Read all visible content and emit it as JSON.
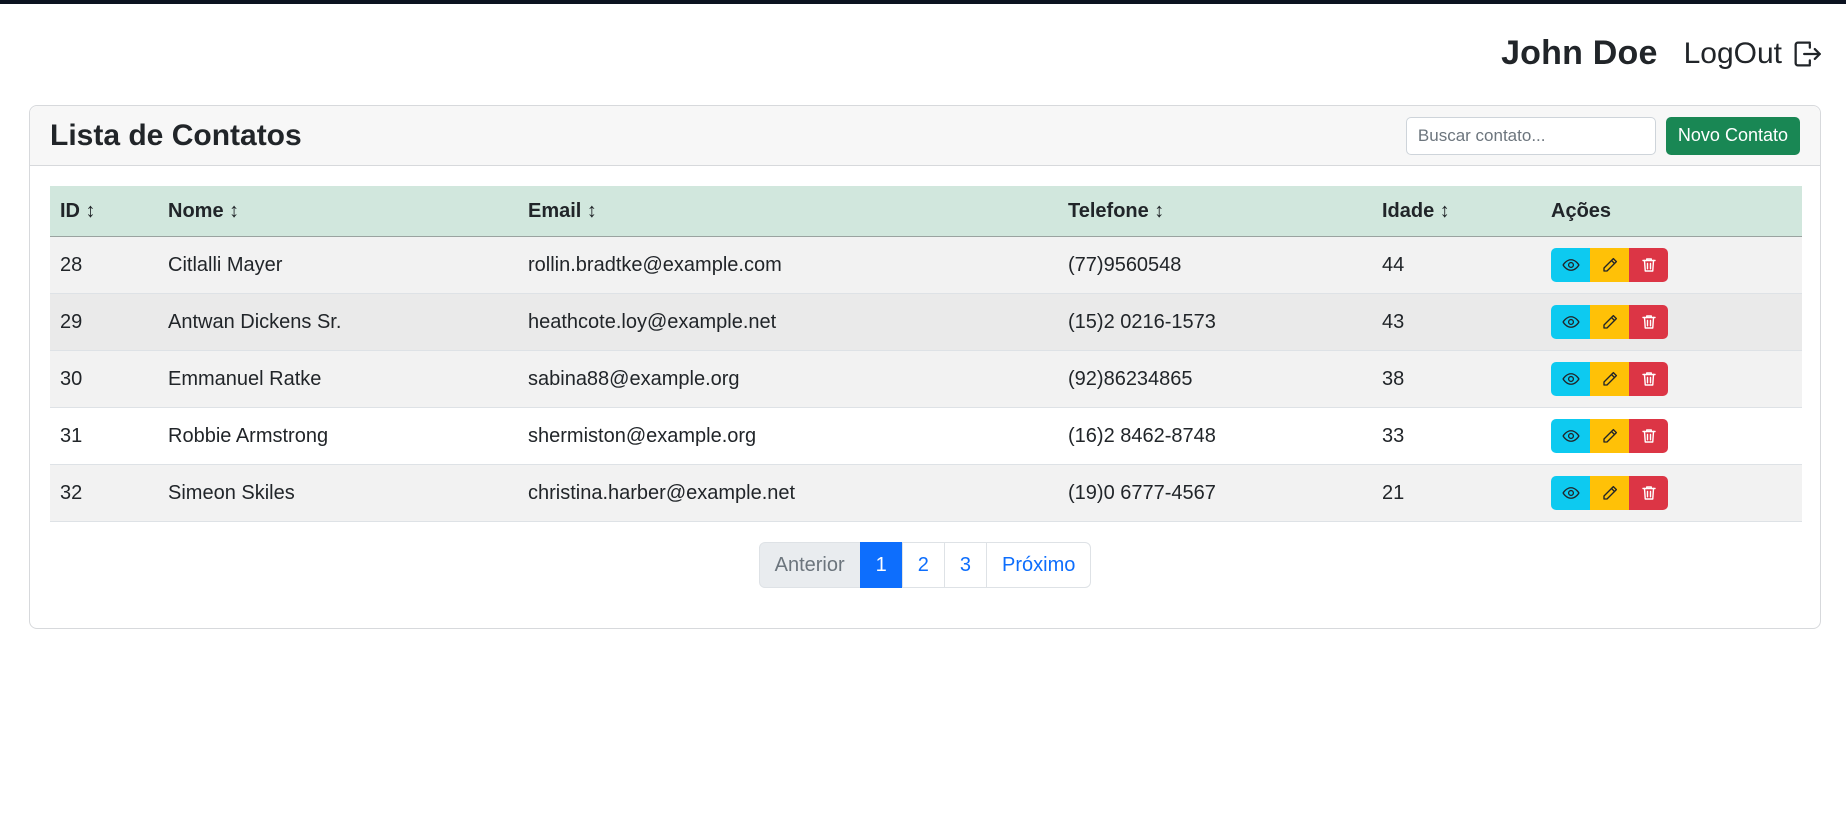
{
  "header": {
    "user_name": "John Doe",
    "logout_label": "LogOut",
    "logout_icon": "logout-icon"
  },
  "card": {
    "title": "Lista de Contatos",
    "search_placeholder": "Buscar contato...",
    "new_button_label": "Novo Contato"
  },
  "table": {
    "columns": [
      "ID ↕",
      "Nome ↕",
      "Email ↕",
      "Telefone ↕",
      "Idade ↕",
      "Ações"
    ],
    "rows": [
      {
        "id": "28",
        "nome": "Citlalli Mayer",
        "email": "rollin.bradtke@example.com",
        "telefone": "(77)9560548",
        "idade": "44"
      },
      {
        "id": "29",
        "nome": "Antwan Dickens Sr.",
        "email": "heathcote.loy@example.net",
        "telefone": "(15)2 0216-1573",
        "idade": "43"
      },
      {
        "id": "30",
        "nome": "Emmanuel Ratke",
        "email": "sabina88@example.org",
        "telefone": "(92)86234865",
        "idade": "38"
      },
      {
        "id": "31",
        "nome": "Robbie Armstrong",
        "email": "shermiston@example.org",
        "telefone": "(16)2 8462-8748",
        "idade": "33"
      },
      {
        "id": "32",
        "nome": "Simeon Skiles",
        "email": "christina.harber@example.net",
        "telefone": "(19)0 6777-4567",
        "idade": "21"
      }
    ],
    "action_icons": [
      "eye-icon",
      "pencil-icon",
      "trash-icon"
    ]
  },
  "pagination": {
    "previous": "Anterior",
    "pages": [
      "1",
      "2",
      "3"
    ],
    "active_page": "1",
    "next": "Próximo"
  },
  "colors": {
    "accent": "#0d6efd",
    "success": "#198754",
    "info": "#0dcaf0",
    "warning": "#ffc107",
    "danger": "#dc3545",
    "table_header": "#d1e7dd"
  }
}
